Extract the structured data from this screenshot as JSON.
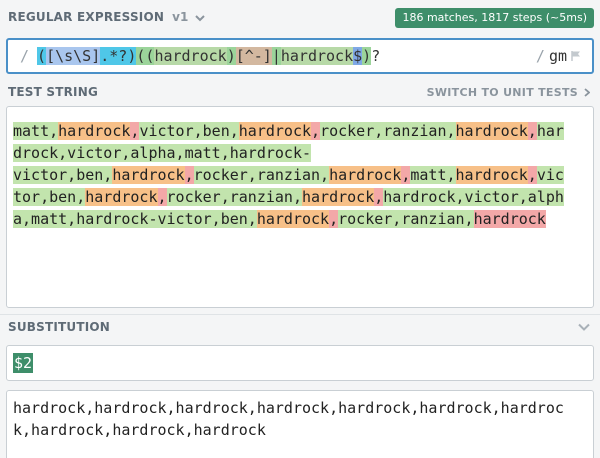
{
  "regex_section": {
    "title": "REGULAR EXPRESSION",
    "version": "v1",
    "match_info": "186 matches, 1817 steps (~5ms)",
    "delimiter": "/",
    "tokens": [
      {
        "text": "(",
        "cls": "g1"
      },
      {
        "text": "[\\s\\S]",
        "cls": "cls"
      },
      {
        "text": ".*?",
        "cls": "g1"
      },
      {
        "text": ")",
        "cls": "g1"
      },
      {
        "text": "(",
        "cls": "g2"
      },
      {
        "text": "(",
        "cls": "g2"
      },
      {
        "text": "hardrock",
        "cls": "inner"
      },
      {
        "text": ")",
        "cls": "g2"
      },
      {
        "text": "[^-]",
        "cls": "cls2"
      },
      {
        "text": "|",
        "cls": "g2"
      },
      {
        "text": "hardrock",
        "cls": "inner"
      },
      {
        "text": "$",
        "cls": "anc"
      },
      {
        "text": ")",
        "cls": "g2"
      },
      {
        "text": "?",
        "cls": ""
      }
    ],
    "flags": "gm",
    "flag_icon": "flag-icon"
  },
  "test_section": {
    "title": "TEST STRING",
    "switch_label": "SWITCH TO UNIT TESTS",
    "lines": [
      [
        [
          "matt,",
          "g"
        ],
        [
          "hardrock",
          "o"
        ],
        [
          ",",
          "r"
        ],
        [
          "victor,ben,",
          "g"
        ],
        [
          "hardrock",
          "o"
        ],
        [
          ",",
          "r"
        ],
        [
          "rocker,ranzian,",
          "g"
        ],
        [
          "hardrock",
          "o"
        ],
        [
          ",",
          "r"
        ],
        [
          "har",
          "g"
        ]
      ],
      [
        [
          "drock,victor,alpha,matt,hardrock-",
          "g"
        ]
      ],
      [
        [
          "victor,ben,",
          "g"
        ],
        [
          "hardrock",
          "o"
        ],
        [
          ",",
          "r"
        ],
        [
          "rocker,ranzian,",
          "g"
        ],
        [
          "hardrock",
          "o"
        ],
        [
          ",",
          "r"
        ],
        [
          "matt,",
          "g"
        ],
        [
          "hardrock",
          "o"
        ],
        [
          ",",
          "r"
        ],
        [
          "vic",
          "g"
        ]
      ],
      [
        [
          "tor,ben,",
          "g"
        ],
        [
          "hardrock",
          "o"
        ],
        [
          ",",
          "r"
        ],
        [
          "rocker,ranzian,",
          "g"
        ],
        [
          "hardrock",
          "o"
        ],
        [
          ",",
          "r"
        ],
        [
          "hardrock,victor,alph",
          "g"
        ]
      ],
      [
        [
          "a,matt,hardrock-victor,ben,",
          "g"
        ],
        [
          "hardrock",
          "o"
        ],
        [
          ",",
          "r"
        ],
        [
          "rocker,ranzian,",
          "g"
        ],
        [
          "hardrock",
          "r"
        ]
      ]
    ]
  },
  "substitution_section": {
    "title": "SUBSTITUTION",
    "value": "$2",
    "result_lines": [
      "hardrock,hardrock,hardrock,hardrock,hardrock,hardrock,hardroc",
      "k,hardrock,hardrock,hardrock"
    ]
  }
}
